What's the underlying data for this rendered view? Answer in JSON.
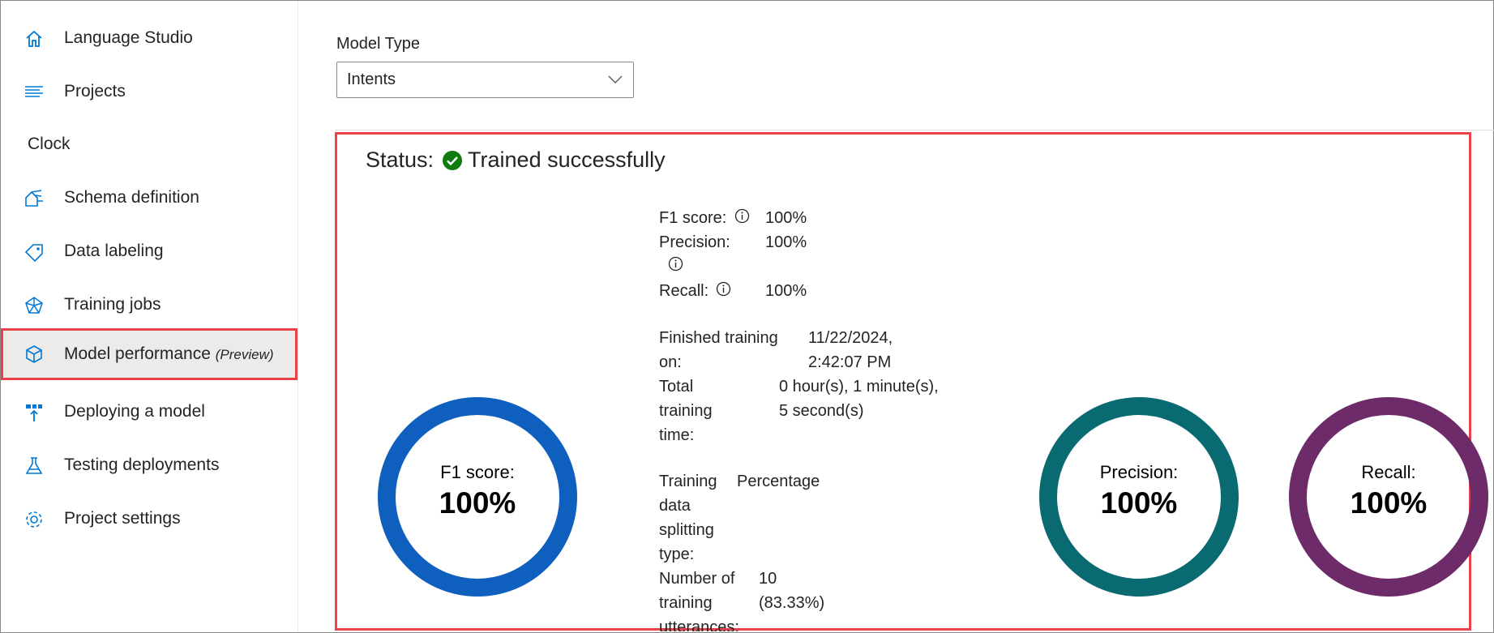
{
  "sidebar": {
    "items_top": [
      {
        "label": "Language Studio",
        "icon": "home-icon"
      },
      {
        "label": "Projects",
        "icon": "list-icon"
      }
    ],
    "project_name": "Clock",
    "items": [
      {
        "label": "Schema definition",
        "icon": "schema-icon"
      },
      {
        "label": "Data labeling",
        "icon": "tag-icon"
      },
      {
        "label": "Training jobs",
        "icon": "training-icon"
      },
      {
        "label": "Model performance",
        "suffix": "(Preview)",
        "icon": "cube-icon",
        "selected": true
      },
      {
        "label": "Deploying a model",
        "icon": "deploy-icon"
      },
      {
        "label": "Testing deployments",
        "icon": "flask-icon"
      },
      {
        "label": "Project settings",
        "icon": "gear-icon"
      }
    ]
  },
  "main": {
    "model_type_label": "Model Type",
    "model_type_value": "Intents",
    "status_label": "Status:",
    "status_value": "Trained successfully",
    "metrics": {
      "f1_label": "F1 score:",
      "f1_value": "100%",
      "precision_label": "Precision:",
      "precision_value": "100%",
      "recall_label": "Recall:",
      "recall_value": "100%"
    },
    "details": {
      "finished_label_1": "Finished training",
      "finished_label_2": "on:",
      "finished_value_1": "11/22/2024,",
      "finished_value_2": "2:42:07 PM",
      "total_label_1": "Total",
      "total_label_2": "training",
      "total_label_3": "time:",
      "total_value_1": "0 hour(s), 1 minute(s),",
      "total_value_2": "5 second(s)",
      "split_label_1": "Training",
      "split_label_2": "data",
      "split_label_3": "splitting",
      "split_label_4": "type:",
      "split_value": "Percentage",
      "utt_label_1": "Number of",
      "utt_label_2": "training",
      "utt_label_3": "utterances:",
      "utt_value_1": "10",
      "utt_value_2": "(83.33%)"
    },
    "rings": [
      {
        "label": "F1 score:",
        "value": "100%",
        "color": "#0f5fbf"
      },
      {
        "label": "Precision:",
        "value": "100%",
        "color": "#0a6a72"
      },
      {
        "label": "Recall:",
        "value": "100%",
        "color": "#6e2b6a"
      }
    ]
  },
  "colors": {
    "highlight": "#e8434b",
    "accent": "#0078d4",
    "success": "#107c10"
  }
}
